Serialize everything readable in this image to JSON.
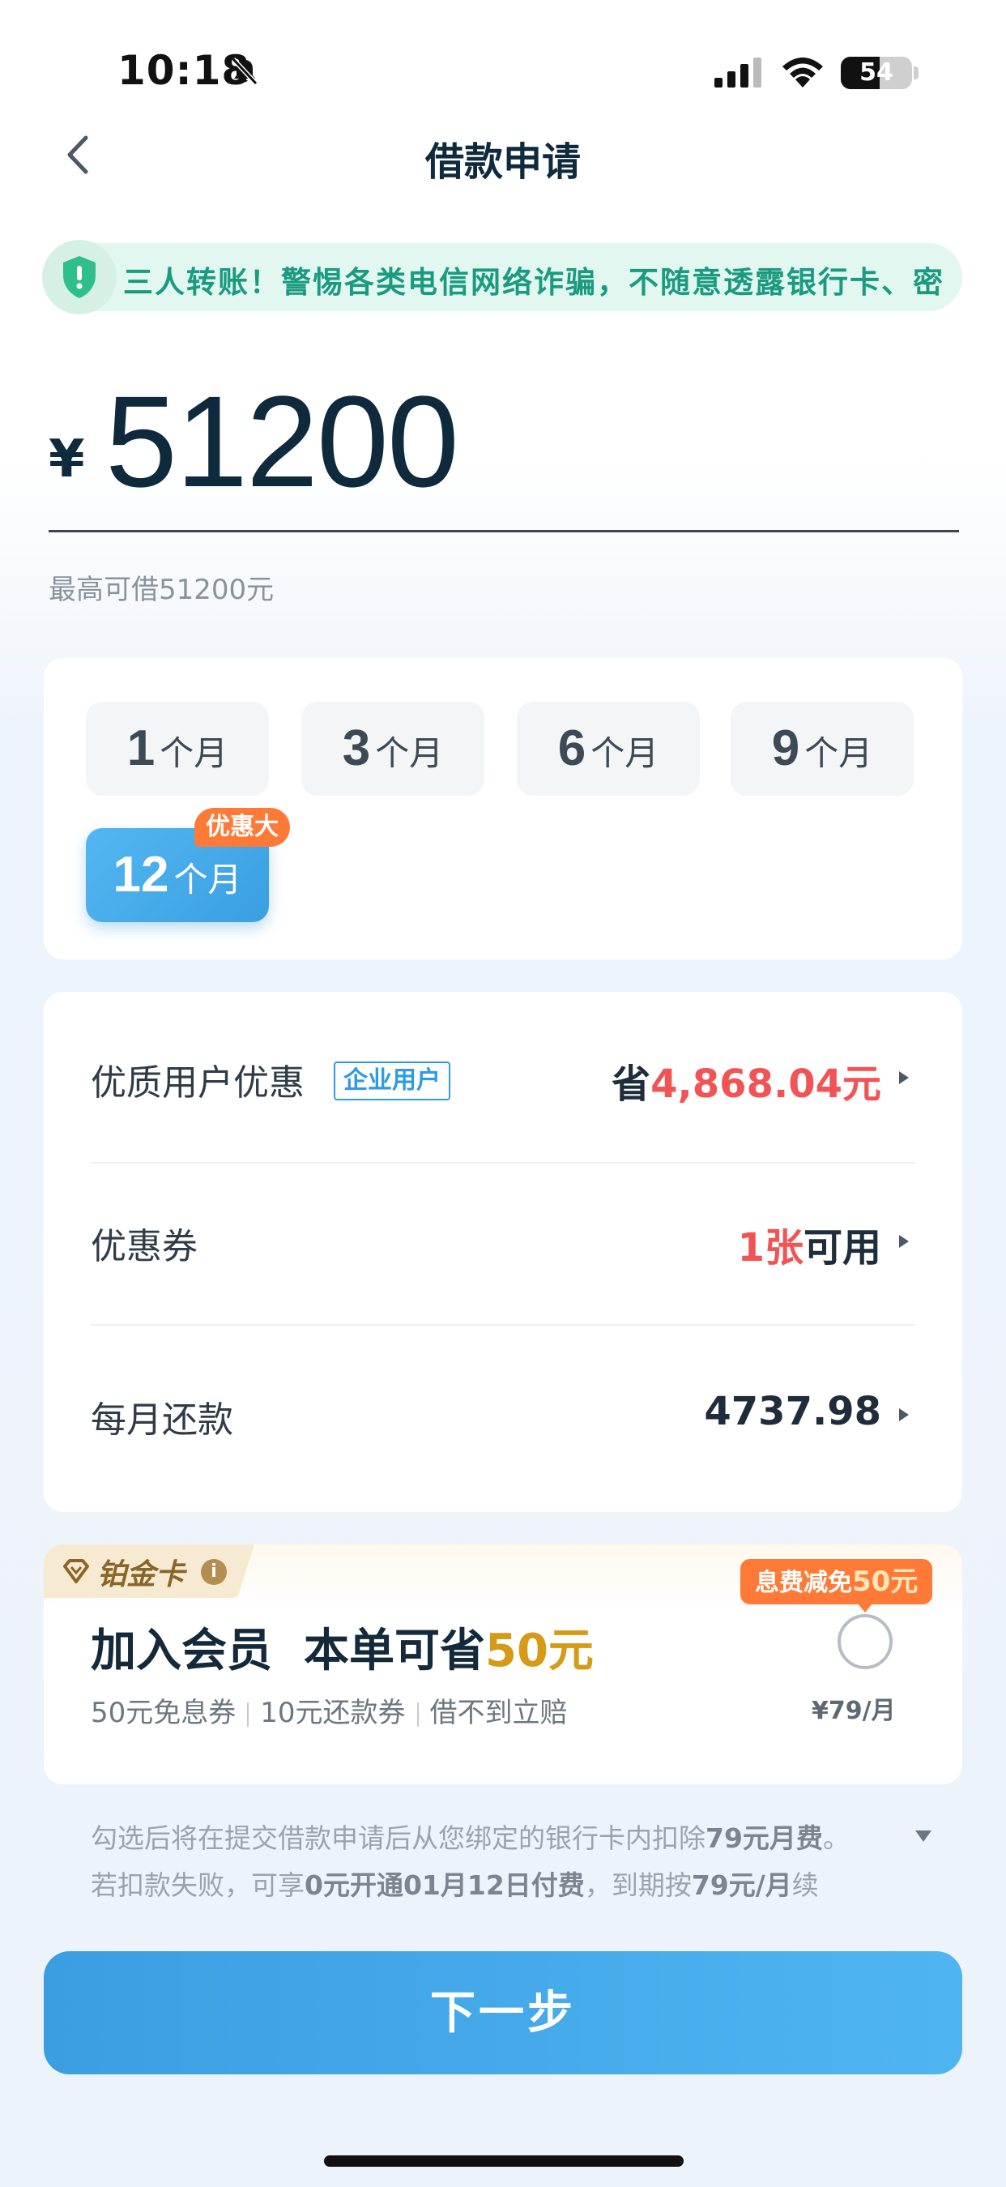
{
  "status_bar": {
    "time": "10:18",
    "battery": "54",
    "battery_level": 0.54
  },
  "nav": {
    "title": "借款申请"
  },
  "notice": {
    "text": "三人转账！警惕各类电信网络诈骗，不随意透露银行卡、密"
  },
  "amount": {
    "currency": "¥",
    "value": "51200",
    "max_hint": "最高可借51200元"
  },
  "terms": {
    "items": [
      {
        "num": "1",
        "unit": "个月"
      },
      {
        "num": "3",
        "unit": "个月"
      },
      {
        "num": "6",
        "unit": "个月"
      },
      {
        "num": "9",
        "unit": "个月"
      },
      {
        "num": "12",
        "unit": "个月"
      }
    ],
    "selected": "12",
    "badge": "优惠大"
  },
  "details": {
    "discount": {
      "label": "优质用户优惠",
      "tag": "企业用户",
      "prefix": "省",
      "value": "4,868.04元"
    },
    "coupon": {
      "label": "优惠券",
      "count": "1张",
      "suffix": "可用"
    },
    "monthly": {
      "label": "每月还款",
      "value": "4737.98"
    }
  },
  "member": {
    "tab_label": "铂金卡",
    "info": "i",
    "title_prefix": "加入会员  本单可省",
    "title_amount": "50元",
    "perks": [
      "50元免息券",
      "10元还款券",
      "借不到立赔"
    ],
    "badge_prefix": "息费减免",
    "badge_amount": "50元",
    "price": "¥79/月"
  },
  "disclaimer": {
    "line1_a": "勾选后将在提交借款申请后从您绑定的银行卡内扣除",
    "line1_b": "79元月费",
    "line1_c": "。",
    "line2_a": "若扣款失败，可享",
    "line2_b": "0元开通01月12日付费",
    "line2_c": "，到期按",
    "line2_d": "79元/月",
    "line2_e": "续"
  },
  "actions": {
    "next": "下一步"
  },
  "colors": {
    "accent": "#3a9fe0",
    "discount_red": "#f05454",
    "badge_orange": "#ff7a36",
    "gold": "#d59a18",
    "notice_green": "#1a9b80"
  }
}
